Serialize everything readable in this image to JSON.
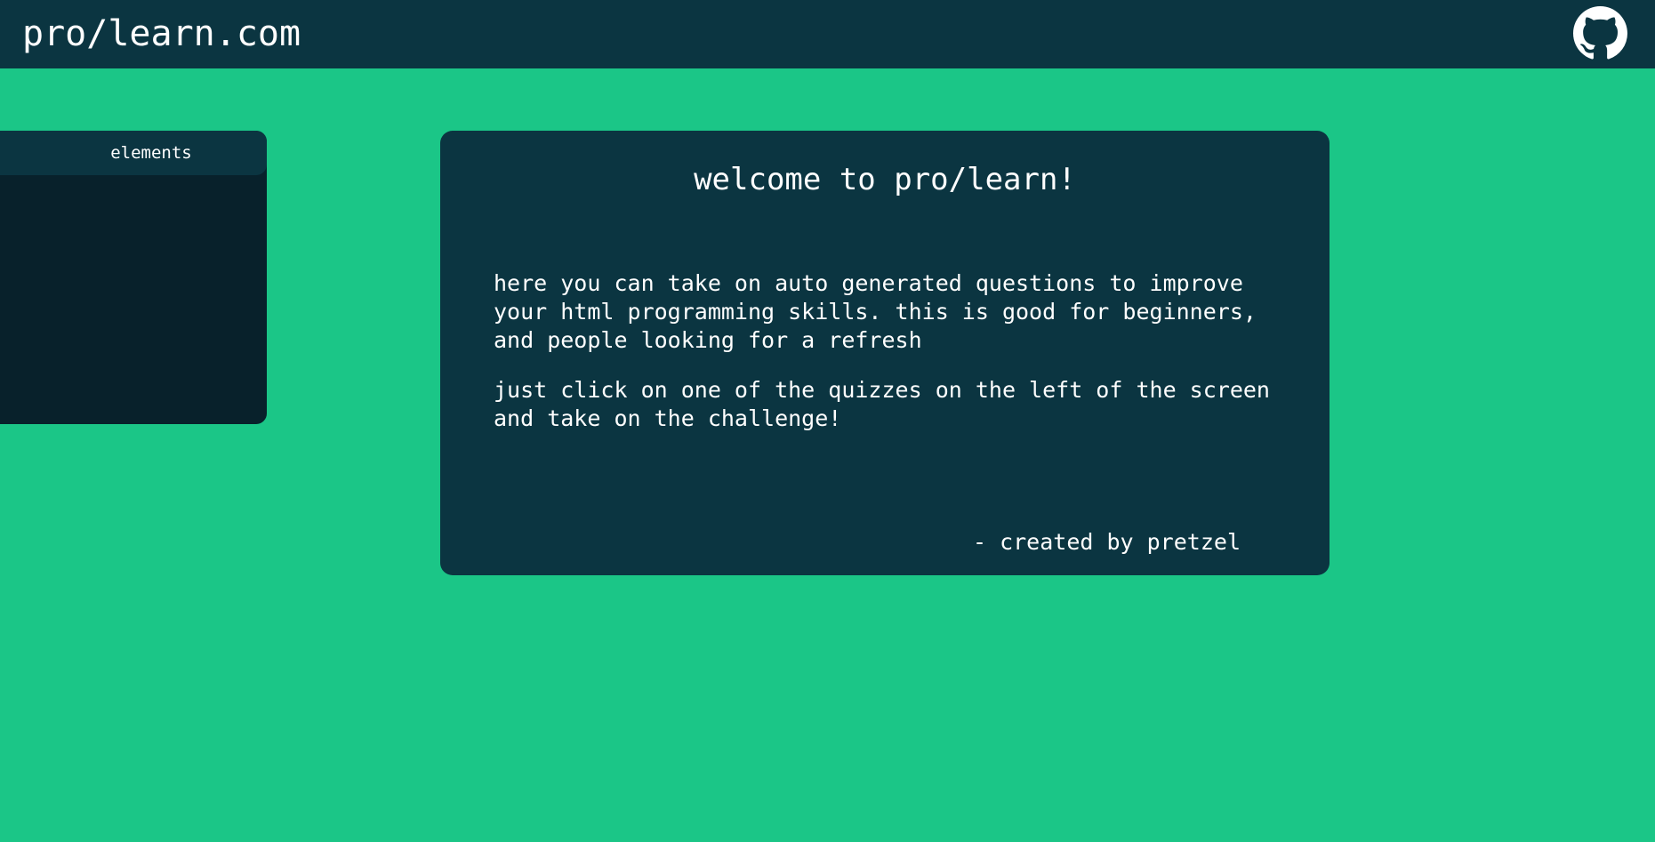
{
  "header": {
    "site_title": "pro/learn.com",
    "github_icon": "github-icon"
  },
  "sidebar": {
    "header_label": "elements",
    "items": []
  },
  "welcome_card": {
    "title": "welcome to pro/learn!",
    "paragraph_1": "here you can take on auto generated questions to improve your html programming skills. this is good for beginners, and people looking for a refresh",
    "paragraph_2": "just click on one of the quizzes on the left of the screen and take on the challenge!",
    "credit": "- created by pretzel"
  },
  "colors": {
    "background": "#1bc687",
    "panel": "#0b3541",
    "sidebar_body": "#08212b",
    "text": "#ffffff"
  }
}
